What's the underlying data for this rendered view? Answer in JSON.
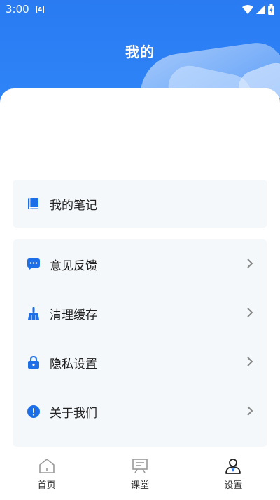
{
  "status_bar": {
    "time": "3:00",
    "notif": "A"
  },
  "header": {
    "title": "我的"
  },
  "group1": [
    {
      "label": "我的笔记",
      "icon": "notebook-icon"
    }
  ],
  "group2": [
    {
      "label": "意见反馈",
      "icon": "chat-icon"
    },
    {
      "label": "清理缓存",
      "icon": "broom-icon"
    },
    {
      "label": "隐私设置",
      "icon": "lock-icon"
    },
    {
      "label": "关于我们",
      "icon": "info-icon"
    }
  ],
  "tabbar": [
    {
      "label": "首页",
      "icon": "home-icon",
      "active": false
    },
    {
      "label": "课堂",
      "icon": "classroom-icon",
      "active": false
    },
    {
      "label": "设置",
      "icon": "user-icon",
      "active": true
    }
  ],
  "colors": {
    "primary": "#2a7bf2",
    "icon_blue": "#1d6fe8",
    "group_bg": "#f5f8fb"
  }
}
